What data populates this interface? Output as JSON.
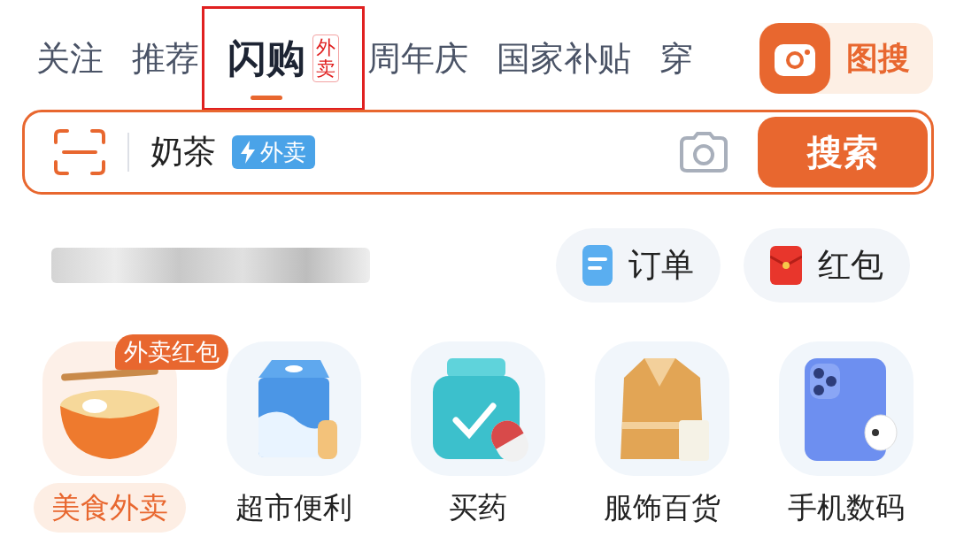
{
  "tabs": [
    {
      "label": "关注",
      "selected": false,
      "highlighted": false
    },
    {
      "label": "推荐",
      "selected": false,
      "highlighted": false
    },
    {
      "label": "闪购",
      "selected": true,
      "badge": "外卖",
      "highlighted": true
    },
    {
      "label": "周年庆",
      "selected": false,
      "highlighted": false
    },
    {
      "label": "国家补贴",
      "selected": false,
      "highlighted": false
    },
    {
      "label": "穿",
      "selected": false,
      "highlighted": false
    }
  ],
  "image_search": {
    "label": "图搜"
  },
  "search": {
    "value": "奶茶",
    "tag": "外卖",
    "button": "搜索"
  },
  "quick_links": [
    {
      "kind": "order",
      "label": "订单"
    },
    {
      "kind": "redpacket",
      "label": "红包"
    }
  ],
  "categories": [
    {
      "kind": "food",
      "label": "美食外卖",
      "selected": true,
      "badge": "外卖红包"
    },
    {
      "kind": "market",
      "label": "超市便利",
      "selected": false
    },
    {
      "kind": "medicine",
      "label": "买药",
      "selected": false
    },
    {
      "kind": "clothing",
      "label": "服饰百货",
      "selected": false
    },
    {
      "kind": "phone",
      "label": "手机数码",
      "selected": false
    }
  ]
}
